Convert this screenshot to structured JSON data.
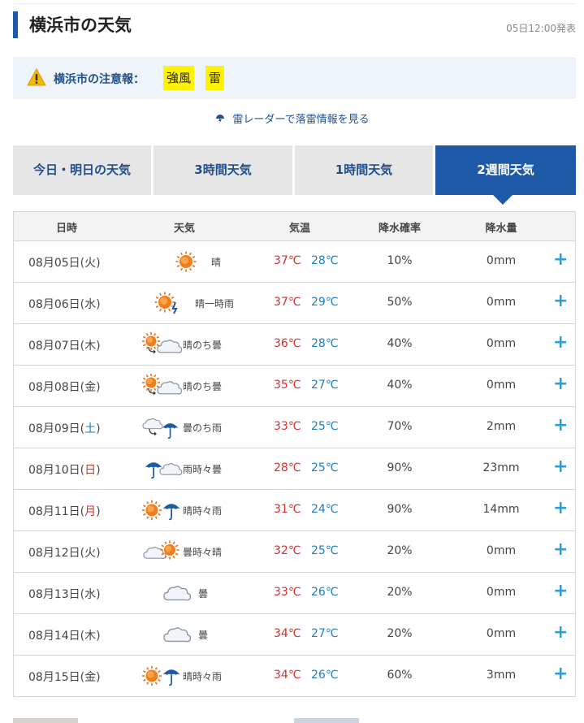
{
  "page": {
    "title": "横浜市の天気",
    "issued": "05日12:00発表"
  },
  "warning": {
    "label": "横浜市の注意報：",
    "tags": [
      "強風",
      "雷"
    ]
  },
  "radar_link": "雷レーダーで落雷情報を見る",
  "tabs": [
    {
      "label": "今日・明日の天気",
      "active": false
    },
    {
      "label": "3時間天気",
      "active": false
    },
    {
      "label": "1時間天気",
      "active": false
    },
    {
      "label": "2週間天気",
      "active": true
    }
  ],
  "table": {
    "headers": [
      "日時",
      "天気",
      "気温",
      "降水確率",
      "降水量"
    ],
    "rows": [
      {
        "date": "08月05日(",
        "dow": "火",
        "dow_type": "weekday",
        "weather": "晴",
        "icon": "sun-icon",
        "hi": "37℃",
        "lo": "28℃",
        "prob": "10%",
        "amount": "0mm"
      },
      {
        "date": "08月06日(",
        "dow": "水",
        "dow_type": "weekday",
        "weather": "晴一時雨",
        "icon": "sun-with-rain-icon",
        "hi": "37℃",
        "lo": "29℃",
        "prob": "50%",
        "amount": "0mm"
      },
      {
        "date": "08月07日(",
        "dow": "木",
        "dow_type": "weekday",
        "weather": "晴のち曇",
        "icon": "sun-then-cloud-icon",
        "hi": "36℃",
        "lo": "28℃",
        "prob": "40%",
        "amount": "0mm"
      },
      {
        "date": "08月08日(",
        "dow": "金",
        "dow_type": "weekday",
        "weather": "晴のち曇",
        "icon": "sun-then-cloud-icon",
        "hi": "35℃",
        "lo": "27℃",
        "prob": "40%",
        "amount": "0mm"
      },
      {
        "date": "08月09日(",
        "dow": "土",
        "dow_type": "sat",
        "weather": "曇のち雨",
        "icon": "cloud-then-umbrella-icon",
        "hi": "33℃",
        "lo": "25℃",
        "prob": "70%",
        "amount": "2mm"
      },
      {
        "date": "08月10日(",
        "dow": "日",
        "dow_type": "sun",
        "weather": "雨時々曇",
        "icon": "umbrella-and-cloud-icon",
        "hi": "28℃",
        "lo": "25℃",
        "prob": "90%",
        "amount": "23mm"
      },
      {
        "date": "08月11日(",
        "dow": "月",
        "dow_type": "sun",
        "weather": "晴時々雨",
        "icon": "sun-and-umbrella-icon",
        "hi": "31℃",
        "lo": "24℃",
        "prob": "90%",
        "amount": "14mm"
      },
      {
        "date": "08月12日(",
        "dow": "火",
        "dow_type": "weekday",
        "weather": "曇時々晴",
        "icon": "cloud-and-sun-icon",
        "hi": "32℃",
        "lo": "25℃",
        "prob": "20%",
        "amount": "0mm"
      },
      {
        "date": "08月13日(",
        "dow": "水",
        "dow_type": "weekday",
        "weather": "曇",
        "icon": "cloud-icon",
        "hi": "33℃",
        "lo": "26℃",
        "prob": "20%",
        "amount": "0mm"
      },
      {
        "date": "08月14日(",
        "dow": "木",
        "dow_type": "weekday",
        "weather": "曇",
        "icon": "cloud-icon",
        "hi": "34℃",
        "lo": "27℃",
        "prob": "20%",
        "amount": "0mm"
      },
      {
        "date": "08月15日(",
        "dow": "金",
        "dow_type": "weekday",
        "weather": "晴時々雨",
        "icon": "sun-and-umbrella-icon",
        "hi": "34℃",
        "lo": "26℃",
        "prob": "60%",
        "amount": "3mm"
      }
    ],
    "expand_label": "+"
  },
  "colors": {
    "accent": "#1f5aa8",
    "hot": "#d0312d",
    "cool": "#1a7ec8",
    "warning_bg": "#eef4fa",
    "tag_bg": "#fff200"
  }
}
